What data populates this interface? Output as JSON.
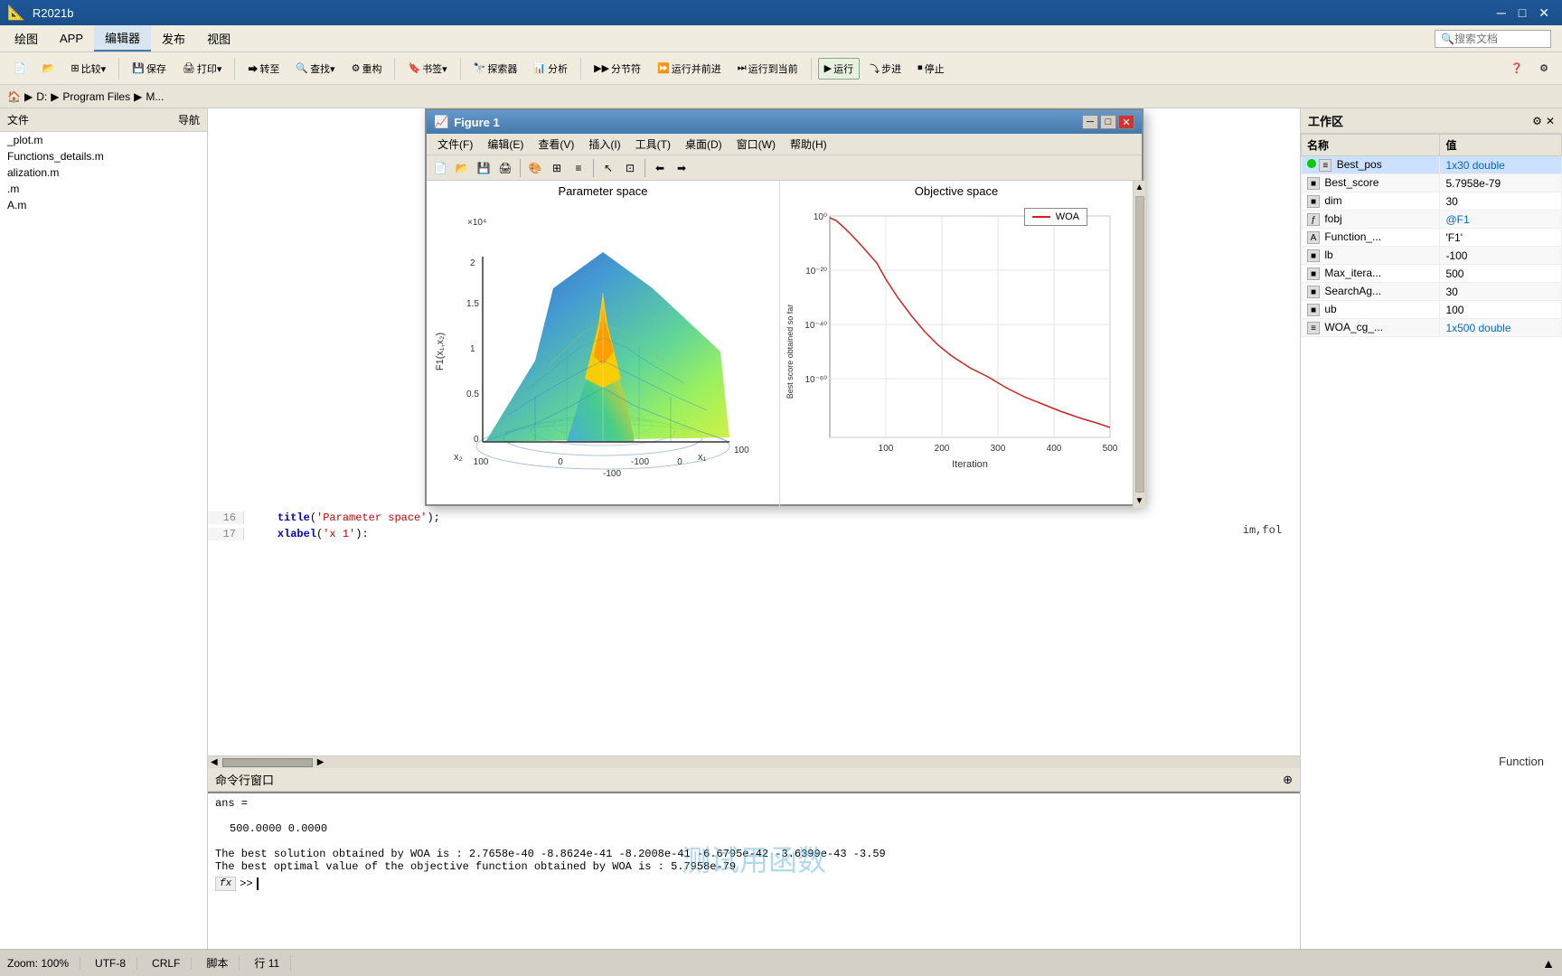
{
  "app": {
    "title": "R2021b",
    "window_controls": [
      "minimize",
      "maximize",
      "close"
    ]
  },
  "menu_tabs": [
    "绘图",
    "APP",
    "编辑器",
    "发布",
    "视图"
  ],
  "active_tab": "编辑器",
  "toolbar": {
    "items": [
      "新建",
      "打开",
      "比较",
      "保存",
      "打印",
      "转至",
      "查找",
      "重构",
      "书签",
      "探索器",
      "分析",
      "运行",
      "运行并前进",
      "运行",
      "步进",
      "停止",
      "分节符",
      "运行到当前"
    ]
  },
  "path_bar": {
    "path": "D: ▶ Program Files ▶ M..."
  },
  "sidebar": {
    "items": [
      "_plot.m",
      "Functions_details.m",
      "alization.m",
      ".m",
      "A.m"
    ]
  },
  "figure_window": {
    "title": "Figure 1",
    "menus": [
      "文件(F)",
      "编辑(E)",
      "查看(V)",
      "插入(I)",
      "工具(T)",
      "桌面(D)",
      "窗口(W)",
      "帮助(H)"
    ],
    "left_plot": {
      "title": "Parameter space",
      "x_label": "x₁",
      "y_label": "x₂",
      "z_label": "F1(x₁,x₂)",
      "x_ticks": [
        "100",
        "0",
        "-100"
      ],
      "y_ticks": [
        "-100",
        "-100"
      ],
      "z_ticks": [
        "0",
        "0.5",
        "1",
        "1.5",
        "2"
      ],
      "z_scale": "×10⁴"
    },
    "right_plot": {
      "title": "Objective space",
      "legend": "WOA",
      "x_label": "Iteration",
      "y_label": "Best score obtained so far",
      "x_ticks": [
        "100",
        "200",
        "300",
        "400",
        "500"
      ],
      "y_ticks": [
        "10⁰",
        "10⁻²⁰",
        "10⁻⁴⁰",
        "10⁻⁶⁰"
      ],
      "y_scale": "log"
    }
  },
  "code_lines": [
    {
      "num": "16",
      "content": "    title('Parameter space');"
    },
    {
      "num": "17",
      "content": "    xlabel('x 1'):"
    }
  ],
  "command_window": {
    "title": "命令行窗口",
    "lines": [
      "ans =",
      "",
      "    500.0000    0.0000",
      "",
      "The best solution obtained by WOA is : 2.7658e-40 -8.8624e-41 -8.2008e-41 -6.6795e-42 -3.6399e-43 -3.59",
      "The best optimal value of the objective function obtained by WOA is : 5.7958e-79"
    ],
    "prompt": "fx >>"
  },
  "watermark": "测试用函数",
  "workspace": {
    "title": "工作区",
    "columns": [
      "名称",
      "值"
    ],
    "rows": [
      {
        "name": "Best_pos",
        "value": "1x30 double",
        "blue": true,
        "icon": "array"
      },
      {
        "name": "Best_score",
        "value": "5.7958e-79",
        "blue": false,
        "icon": "scalar"
      },
      {
        "name": "dim",
        "value": "30",
        "blue": false,
        "icon": "scalar"
      },
      {
        "name": "fobj",
        "value": "@F1",
        "blue": true,
        "icon": "func"
      },
      {
        "name": "Function_...",
        "value": "'F1'",
        "blue": false,
        "icon": "str"
      },
      {
        "name": "lb",
        "value": "-100",
        "blue": false,
        "icon": "scalar"
      },
      {
        "name": "Max_itera...",
        "value": "500",
        "blue": false,
        "icon": "scalar"
      },
      {
        "name": "SearchAg...",
        "value": "30",
        "blue": false,
        "icon": "scalar"
      },
      {
        "name": "ub",
        "value": "100",
        "blue": false,
        "icon": "scalar"
      },
      {
        "name": "WOA_cg_...",
        "value": "1x500 double",
        "blue": true,
        "icon": "array"
      }
    ]
  },
  "status_bar": {
    "zoom": "Zoom: 100%",
    "encoding": "UTF-8",
    "eol": "CRLF",
    "language": "脚本",
    "position": "行 11"
  },
  "code_partial": "                            im,fol"
}
